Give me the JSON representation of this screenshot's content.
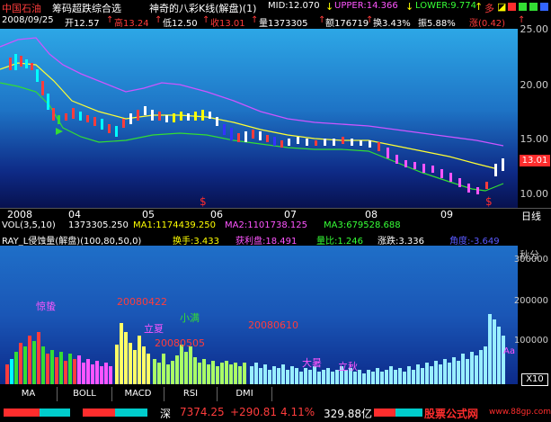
{
  "header": {
    "stock_name": "中国石油",
    "indicator_name": "筹码超跌综合选",
    "indicator_sub": "神奇的八彩K线(解盘)(1)",
    "mid_label": "MID:12.070",
    "mid_arrow": "↓",
    "upper_label": "UPPER:14.366",
    "upper_arrow": "↓",
    "lower_label": "LOWER:9.774",
    "lower_arrow": "↑",
    "duo_label": "多",
    "duo_icons": "◪"
  },
  "ohlc": {
    "date": "2008/09/25",
    "open": "开12.57",
    "open_arrow": "↑",
    "high": "高13.24",
    "high_arrow": "↑",
    "low": "低12.50",
    "low_arrow": "↑",
    "close": "收13.01",
    "close_arrow": "↑",
    "volume": "量1373305",
    "vol_arrow": "↑",
    "amount": "额176719",
    "amount_arrow": "↑",
    "turnover": "换3.43%",
    "amplitude": "振5.88%",
    "change": "涨(0.42)",
    "change_arrow": "↑"
  },
  "main_axis": {
    "ticks": [
      "25.00",
      "20.00",
      "15.00",
      "10.00"
    ],
    "price_tag": "13.01",
    "bottom_label": "日线"
  },
  "date_axis": {
    "labels": [
      "2008",
      "04",
      "05",
      "06",
      "07",
      "08",
      "09"
    ]
  },
  "vol_line": {
    "name": "VOL(3,5,10)",
    "value": "1373305.250",
    "ma1": "MA1:1174439.250",
    "ma2": "MA2:1101738.125",
    "ma3": "MA3:679528.688"
  },
  "ray_line": {
    "name": "RAY_L侵蚀量(解盘)(100,80,50,0)",
    "huanshou": "换手:3.433",
    "huolipan": "获利盘:18.491",
    "liangbi": "量比:1.246",
    "zhangdie": "涨跌:3.336",
    "jiaodu": "角度:-3.649",
    "corner": "秋分"
  },
  "ind_axis": {
    "ticks": [
      "300000",
      "200000",
      "100000"
    ],
    "bottom_label": "X10"
  },
  "ind_labels": {
    "jingzhe": "惊蛰",
    "d0422": "20080422",
    "lixia": "立夏",
    "xiaoman": "小满",
    "d0505": "20080505",
    "d0610": "20080610",
    "dashu": "大暑",
    "lichun": "立秋",
    "small_a": "Aa"
  },
  "tabs": [
    "MA",
    "BOLL",
    "MACD",
    "RSI",
    "DMI"
  ],
  "status": {
    "market": "深",
    "index": "7374.25",
    "change": "+290.81",
    "pct": "4.11%",
    "amount": "329.88亿",
    "site": "股票公式网",
    "url": "www.88gp.com"
  },
  "colors": {
    "upper_band": "#cc55ff",
    "lower_band": "#33dd33",
    "mid_band": "#ffff33",
    "price_up": "#ff3c3c"
  }
}
